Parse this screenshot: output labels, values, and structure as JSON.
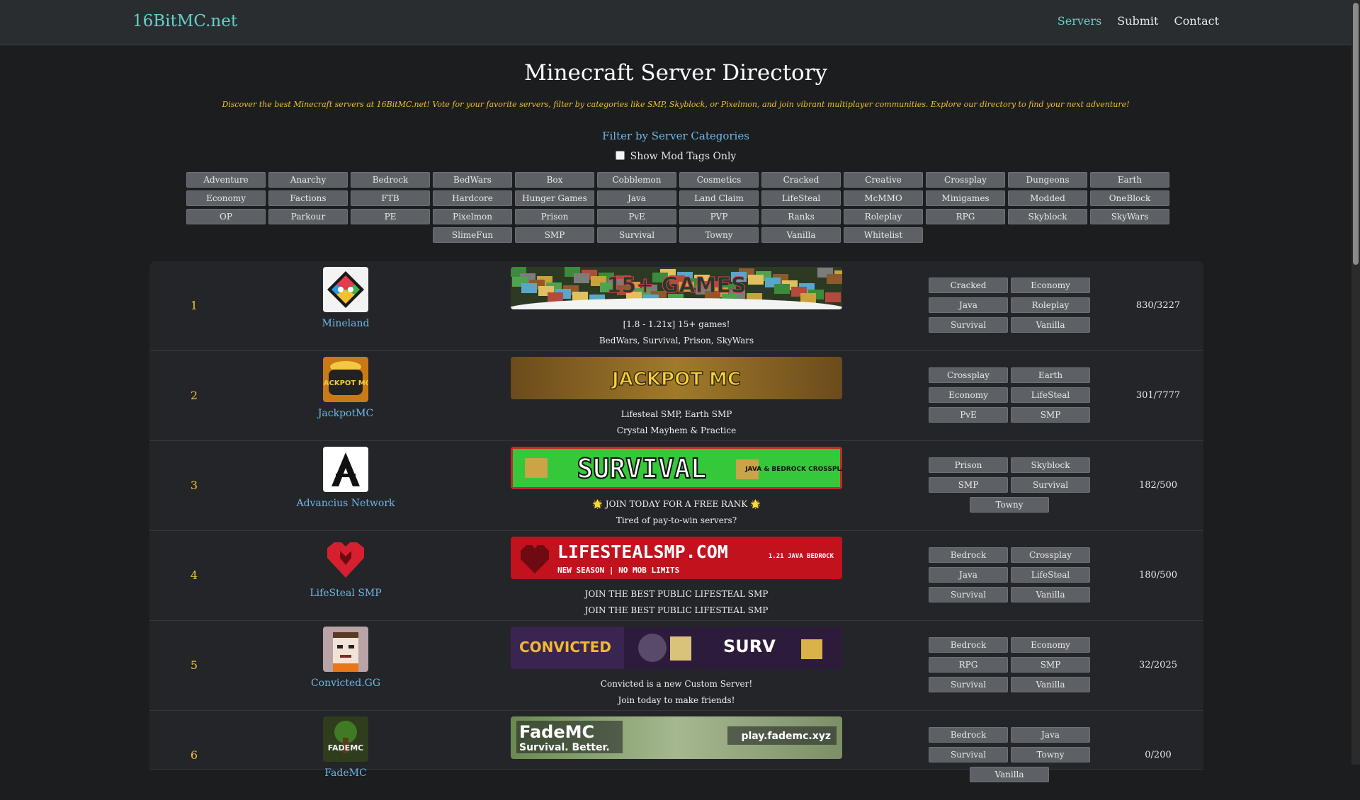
{
  "nav": {
    "brand": "16BitMC.net",
    "links": [
      "Servers",
      "Submit",
      "Contact"
    ]
  },
  "header": {
    "title": "Minecraft Server Directory",
    "subtitle": "Discover the best Minecraft servers at 16BitMC.net! Vote for your favorite servers, filter by categories like SMP, Skyblock, or Pixelmon, and join vibrant multiplayer communities. Explore our directory to find your next adventure!"
  },
  "filter": {
    "title": "Filter by Server Categories",
    "mod_toggle_label": "Show Mod Tags Only",
    "categories": [
      "Adventure",
      "Anarchy",
      "Bedrock",
      "BedWars",
      "Box",
      "Cobblemon",
      "Cosmetics",
      "Cracked",
      "Creative",
      "Crossplay",
      "Dungeons",
      "Earth",
      "Economy",
      "Factions",
      "FTB",
      "Hardcore",
      "Hunger Games",
      "Java",
      "Land Claim",
      "LifeSteal",
      "McMMO",
      "Minigames",
      "Modded",
      "OneBlock",
      "OP",
      "Parkour",
      "PE",
      "Pixelmon",
      "Prison",
      "PvE",
      "PVP",
      "Ranks",
      "Roleplay",
      "RPG",
      "Skyblock",
      "SkyWars",
      "SlimeFun",
      "SMP",
      "Survival",
      "Towny",
      "Vanilla",
      "Whitelist"
    ]
  },
  "colors": {
    "accent": "#5fd3c8",
    "link": "#6fb8e8",
    "rank": "#f2c12e",
    "background": "#1b1d1f",
    "tag": "#5d6166"
  },
  "servers": [
    {
      "rank": "1",
      "name": "Mineland",
      "desc1": "[1.8 - 1.21x] 15+ games!",
      "desc2": "BedWars, Survival, Prison, SkyWars",
      "tags": [
        "Cracked",
        "Economy",
        "Java",
        "Roleplay",
        "Survival",
        "Vanilla"
      ],
      "players": "830/3227",
      "banner_text": "15+ GAMES"
    },
    {
      "rank": "2",
      "name": "JackpotMC",
      "desc1": "Lifesteal SMP, Earth SMP",
      "desc2": "Crystal Mayhem & Practice",
      "tags": [
        "Crossplay",
        "Earth",
        "Economy",
        "LifeSteal",
        "PvE",
        "SMP"
      ],
      "players": "301/7777",
      "banner_text": "JACKPOT MC",
      "logo_text": "JACKPOT MC"
    },
    {
      "rank": "3",
      "name": "Advancius Network",
      "desc1": "🌟 JOIN TODAY FOR A FREE RANK 🌟",
      "desc2": "Tired of pay-to-win servers?",
      "tags": [
        "Prison",
        "Skyblock",
        "SMP",
        "Survival",
        "Towny"
      ],
      "players": "182/500",
      "banner_text": "SURVIVAL",
      "banner_side": "JAVA & BEDROCK CROSSPLAY"
    },
    {
      "rank": "4",
      "name": "LifeSteal SMP",
      "desc1": "JOIN THE BEST PUBLIC LIFESTEAL SMP",
      "desc2": "JOIN THE BEST PUBLIC LIFESTEAL SMP",
      "tags": [
        "Bedrock",
        "Crossplay",
        "Java",
        "LifeSteal",
        "Survival",
        "Vanilla"
      ],
      "players": "180/500",
      "banner_text": "LIFESTEALSMP.COM",
      "banner_sub": "NEW SEASON | NO MOB LIMITS",
      "banner_side": "1.21 JAVA BEDROCK"
    },
    {
      "rank": "5",
      "name": "Convicted.GG",
      "desc1": "Convicted is a new Custom Server!",
      "desc2": "Join today to make friends!",
      "tags": [
        "Bedrock",
        "Economy",
        "RPG",
        "SMP",
        "Survival",
        "Vanilla"
      ],
      "players": "32/2025",
      "banner_text": "CONVICTED",
      "banner_side": "SURV"
    },
    {
      "rank": "6",
      "name": "FadeMC",
      "desc1": "",
      "desc2": "",
      "tags": [
        "Bedrock",
        "Java",
        "Survival",
        "Towny",
        "Vanilla"
      ],
      "players": "0/200",
      "banner_text": "FadeMC",
      "banner_sub": "Survival. Better.",
      "banner_side": "play.fademc.xyz",
      "logo_text": "FADEMC"
    }
  ]
}
